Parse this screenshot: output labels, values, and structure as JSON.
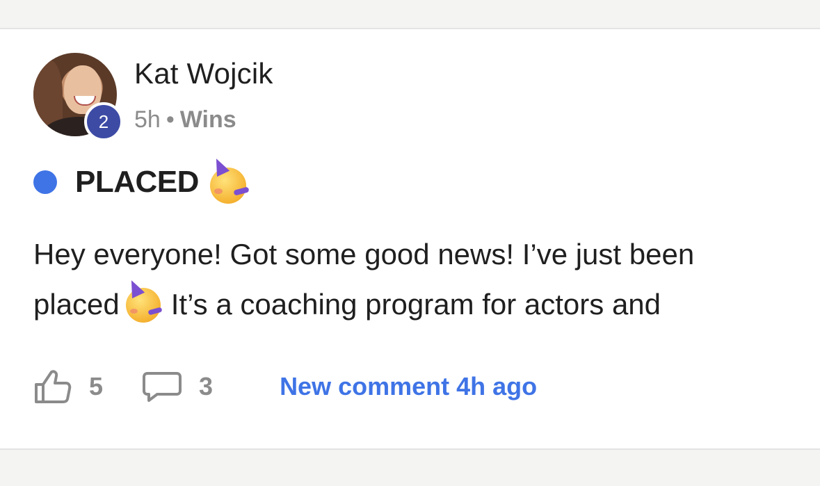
{
  "post": {
    "author": "Kat Wojcik",
    "level": "2",
    "time": "5h",
    "separator": "•",
    "category": "Wins",
    "tag": {
      "label": "PLACED",
      "color": "#3f74e6",
      "emoji": "partying-face-emoji"
    },
    "body": {
      "line1": "Hey everyone! Got some good news! I’ve just been",
      "line2_before": "placed",
      "line2_after": "It’s a coaching program for actors and"
    },
    "actions": {
      "likes": "5",
      "comments": "3",
      "new_comment": "New comment 4h ago"
    }
  },
  "colors": {
    "accent": "#3f74e6",
    "level_badge": "#3d4ba5",
    "muted_text": "#8b8b8b"
  }
}
